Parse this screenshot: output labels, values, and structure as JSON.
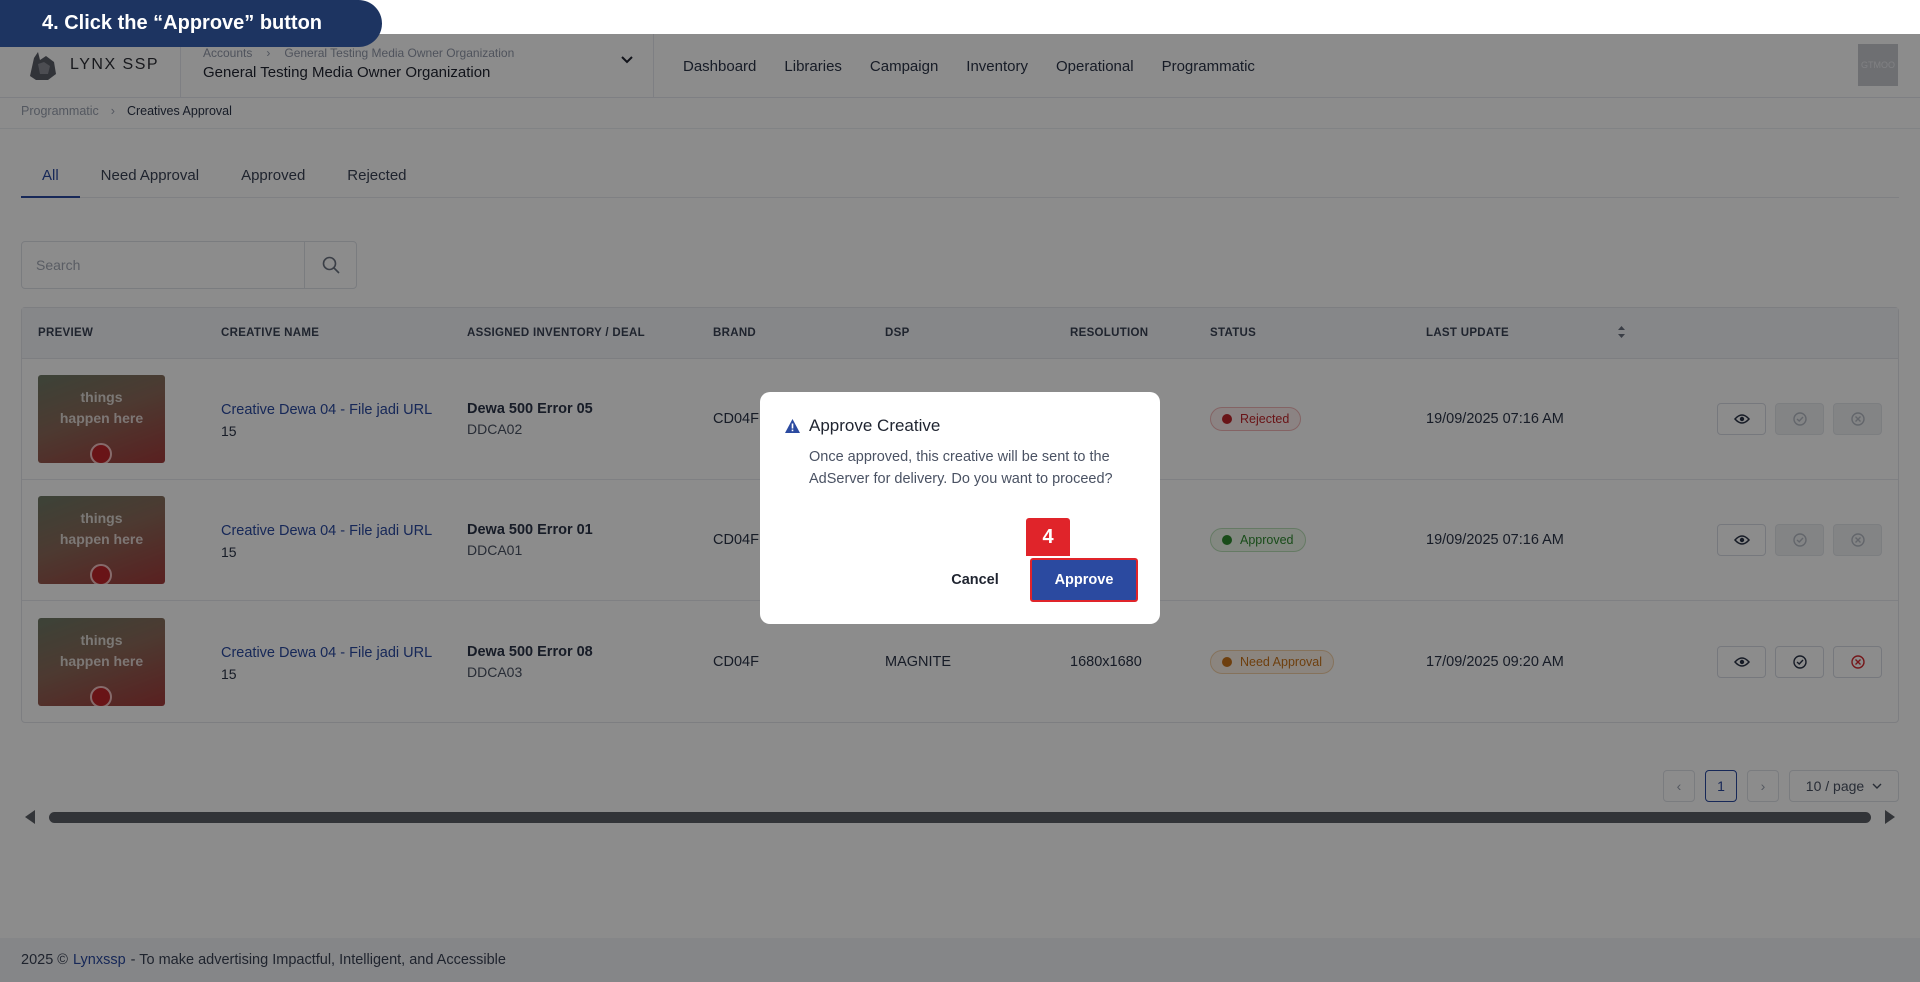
{
  "instruction": "4. Click the “Approve” button",
  "step_number": "4",
  "header": {
    "logo_text": "LYNX SSP",
    "org_breadcrumb": [
      "Accounts",
      "General Testing Media Owner Organization"
    ],
    "org_name": "General Testing Media Owner Organization",
    "nav": [
      "Dashboard",
      "Libraries",
      "Campaign",
      "Inventory",
      "Operational",
      "Programmatic"
    ],
    "avatar_text": "GTMOO"
  },
  "breadcrumb": {
    "parent": "Programmatic",
    "current": "Creatives Approval"
  },
  "tabs": [
    "All",
    "Need Approval",
    "Approved",
    "Rejected"
  ],
  "search": {
    "placeholder": "Search",
    "value": ""
  },
  "table": {
    "columns": [
      "PREVIEW",
      "CREATIVE NAME",
      "ASSIGNED INVENTORY / DEAL",
      "BRAND",
      "DSP",
      "RESOLUTION",
      "STATUS",
      "LAST UPDATE"
    ],
    "rows": [
      {
        "thumb_text": [
          "things",
          "happen here"
        ],
        "name": "Creative Dewa 04 - File jadi URL",
        "id": "15",
        "inventory": "Dewa 500 Error 05",
        "deal": "DDCA02",
        "brand": "CD04F",
        "dsp": "",
        "resolution": "",
        "status": "Rejected",
        "last_update": "19/09/2025 07:16 AM"
      },
      {
        "thumb_text": [
          "things",
          "happen here"
        ],
        "name": "Creative Dewa 04 - File jadi URL",
        "id": "15",
        "inventory": "Dewa 500 Error 01",
        "deal": "DDCA01",
        "brand": "CD04F",
        "dsp": "",
        "resolution": "",
        "status": "Approved",
        "last_update": "19/09/2025 07:16 AM"
      },
      {
        "thumb_text": [
          "things",
          "happen here"
        ],
        "name": "Creative Dewa 04 - File jadi URL",
        "id": "15",
        "inventory": "Dewa 500 Error 08",
        "deal": "DDCA03",
        "brand": "CD04F",
        "dsp": "MAGNITE",
        "resolution": "1680x1680",
        "status": "Need Approval",
        "last_update": "17/09/2025 09:20 AM"
      }
    ]
  },
  "pagination": {
    "current_page": "1",
    "page_size": "10 / page"
  },
  "footer": {
    "prefix": "2025 ©",
    "brand": "Lynxssp",
    "tagline": "- To make advertising Impactful, Intelligent, and Accessible"
  },
  "modal": {
    "title": "Approve Creative",
    "body": "Once approved, this creative will be sent to the AdServer for delivery. Do you want to proceed?",
    "cancel_label": "Cancel",
    "approve_label": "Approve"
  },
  "colors": {
    "primary": "#2b4aa0",
    "highlight": "#e0242a",
    "instruction_bg": "#1d3461"
  }
}
